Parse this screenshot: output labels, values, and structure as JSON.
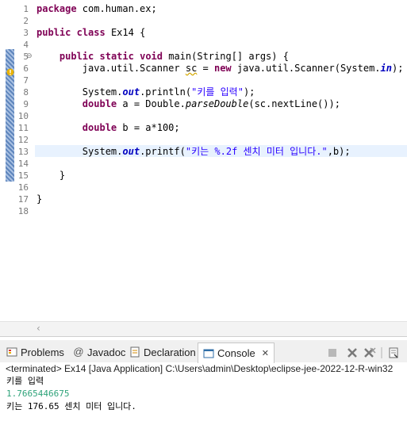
{
  "editor": {
    "line_numbers": [
      "1",
      "2",
      "3",
      "4",
      "5",
      "6",
      "7",
      "8",
      "9",
      "10",
      "11",
      "12",
      "13",
      "14",
      "15",
      "16",
      "17",
      "18"
    ],
    "lines": [
      [
        {
          "t": "package",
          "c": "kw"
        },
        {
          "t": " com.human.ex;",
          "c": ""
        }
      ],
      [],
      [
        {
          "t": "public",
          "c": "kw"
        },
        {
          "t": " ",
          "c": ""
        },
        {
          "t": "class",
          "c": "kw"
        },
        {
          "t": " Ex14 {",
          "c": ""
        }
      ],
      [],
      [
        {
          "t": "    ",
          "c": ""
        },
        {
          "t": "public",
          "c": "kw"
        },
        {
          "t": " ",
          "c": ""
        },
        {
          "t": "static",
          "c": "kw"
        },
        {
          "t": " ",
          "c": ""
        },
        {
          "t": "void",
          "c": "kw"
        },
        {
          "t": " main(String[] args) {",
          "c": ""
        }
      ],
      [
        {
          "t": "        java.util.Scanner ",
          "c": ""
        },
        {
          "t": "sc",
          "c": "ul"
        },
        {
          "t": " = ",
          "c": ""
        },
        {
          "t": "new",
          "c": "kw"
        },
        {
          "t": " java.util.Scanner(System.",
          "c": ""
        },
        {
          "t": "in",
          "c": "fld"
        },
        {
          "t": ");",
          "c": ""
        }
      ],
      [],
      [
        {
          "t": "        System.",
          "c": ""
        },
        {
          "t": "out",
          "c": "fld"
        },
        {
          "t": ".println(",
          "c": ""
        },
        {
          "t": "\"키를 입력\"",
          "c": "str"
        },
        {
          "t": ");",
          "c": ""
        }
      ],
      [
        {
          "t": "        ",
          "c": ""
        },
        {
          "t": "double",
          "c": "kw"
        },
        {
          "t": " a = Double.",
          "c": ""
        },
        {
          "t": "parseDouble",
          "c": "ital"
        },
        {
          "t": "(sc.nextLine());",
          "c": ""
        }
      ],
      [],
      [
        {
          "t": "        ",
          "c": ""
        },
        {
          "t": "double",
          "c": "kw"
        },
        {
          "t": " b = a*100;",
          "c": ""
        }
      ],
      [],
      [
        {
          "t": "        System.",
          "c": ""
        },
        {
          "t": "out",
          "c": "fld"
        },
        {
          "t": ".printf(",
          "c": ""
        },
        {
          "t": "\"키는 %.2f 센치 미터 입니다.\"",
          "c": "str"
        },
        {
          "t": ",b);",
          "c": ""
        }
      ],
      [],
      [
        {
          "t": "    }",
          "c": ""
        }
      ],
      [],
      [
        {
          "t": "}",
          "c": ""
        }
      ],
      []
    ],
    "fold_markers": {
      "5": "⊖"
    },
    "current_line": 13
  },
  "views": {
    "tabs": [
      {
        "label": "Problems",
        "icon": "problems-icon"
      },
      {
        "label": "Javadoc",
        "icon": "javadoc-icon"
      },
      {
        "label": "Declaration",
        "icon": "declaration-icon"
      },
      {
        "label": "Console",
        "icon": "console-icon",
        "active": true
      }
    ],
    "close_glyph": "✕",
    "status": "<terminated> Ex14 [Java Application] C:\\Users\\admin\\Desktop\\eclipse-jee-2022-12-R-win32",
    "output": [
      {
        "text": "키를 입력",
        "kind": "stdout"
      },
      {
        "text": "1.7665446675",
        "kind": "stdin"
      },
      {
        "text": "키는 176.65 센치 미터 입니다.",
        "kind": "stdout"
      }
    ]
  },
  "colors": {
    "keyword": "#7f0055",
    "string": "#2a00ff",
    "field": "#0000c0",
    "stdin": "#2fa37a",
    "current_line": "#e8f2fe"
  }
}
